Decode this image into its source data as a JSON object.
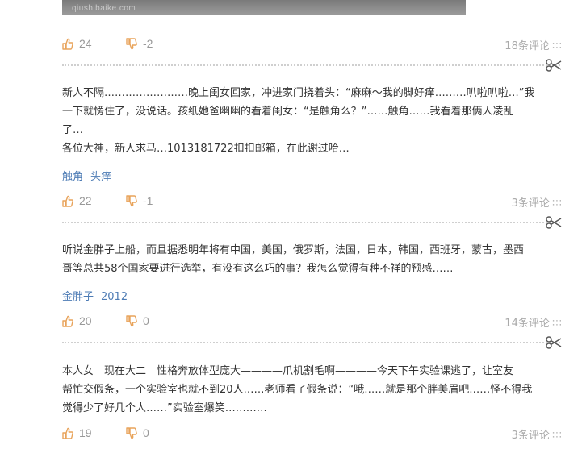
{
  "image_watermark": "qiushibaike.com",
  "items": [
    {
      "up": "24",
      "down": "-2",
      "comments": "18条评论",
      "dots": "∶∶∶",
      "text": [],
      "tags": []
    },
    {
      "up": "22",
      "down": "-1",
      "comments": "3条评论",
      "dots": "∶∶∶",
      "text": [
        "新人不隔……………………晚上闺女回家，冲进家门挠着头：“麻麻～我的脚好痒………叭啦叭啦…”我",
        "一下就愣住了，没说话。孩纸她爸幽幽的看着闺女：“是触角么？”……触角……我看着那俩人凌乱",
        "了…",
        "各位大神，新人求马…1013181722扣扣邮箱，在此谢过哈…"
      ],
      "tags": [
        "触角",
        "头痒"
      ]
    },
    {
      "up": "20",
      "down": "0",
      "comments": "14条评论",
      "dots": "∶∶∶",
      "text": [
        "听说金胖子上船，而且据悉明年将有中国，美国，俄罗斯，法国，日本，韩国，西班牙，蒙古，墨西",
        "哥等总共58个国家要进行选举，有没有这么巧的事？我怎么觉得有种不祥的预感……"
      ],
      "tags": [
        "金胖子",
        "2012"
      ]
    },
    {
      "up": "19",
      "down": "0",
      "comments": "3条评论",
      "dots": "∶∶∶",
      "text": [
        "本人女　现在大二　性格奔放体型庞大————爪机割毛啊————今天下午实验课逃了，让室友",
        "帮忙交假条，一个实验室也就不到20人……老师看了假条说：“哦……就是那个胖美眉吧……怪不得我",
        "觉得少了好几个人……”实验室爆笑…………"
      ],
      "tags": []
    }
  ],
  "icons": {
    "up": "thumbs-up-icon",
    "down": "thumbs-down-icon",
    "cut": "scissors-icon"
  },
  "colors": {
    "icon_orange": "#e8a35a",
    "tag_blue": "#4e7cb5",
    "meta_gray": "#999999"
  }
}
